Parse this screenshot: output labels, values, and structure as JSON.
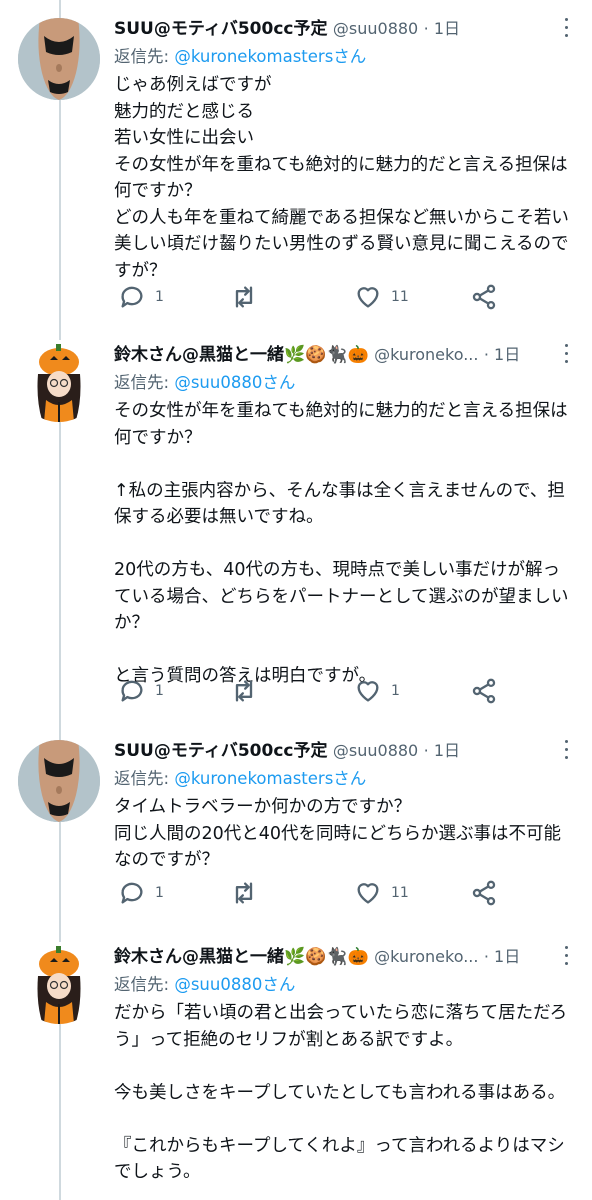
{
  "tweets": [
    {
      "author": "SUU@モティバ500cc予定",
      "handle": "@suu0880",
      "time": "· 1日",
      "reply_prefix": "返信先: ",
      "reply_to": "@kuronekomastersさん",
      "text": "じゃあ例えばですが\n魅力的だと感じる\n若い女性に出会い\nその女性が年を重ねても絶対的に魅力的だと言える担保は何ですか？\nどの人も年を重ねて綺麗である担保など無いからこそ若い美しい頃だけ齧りたい男性のずる賢い意見に聞こえるのですが？",
      "replies": "1",
      "retweets": "",
      "likes": "11"
    },
    {
      "author": "鈴木さん@黒猫と一緒",
      "emojis": [
        "🌿",
        "🍪",
        "🐈‍⬛",
        "🎃"
      ],
      "handle": "@kuroneko...",
      "time": "· 1日",
      "reply_prefix": "返信先: ",
      "reply_to": "@suu0880さん",
      "text": "その女性が年を重ねても絶対的に魅力的だと言える担保は何ですか？\n\n↑私の主張内容から、そんな事は全く言えませんので、担保する必要は無いですね。\n\n20代の方も、40代の方も、現時点で美しい事だけが解っている場合、どちらをパートナーとして選ぶのが望ましいか？\n\nと言う質問の答えは明白ですが。",
      "replies": "1",
      "retweets": "",
      "likes": "1"
    },
    {
      "author": "SUU@モティバ500cc予定",
      "handle": "@suu0880",
      "time": "· 1日",
      "reply_prefix": "返信先: ",
      "reply_to": "@kuronekomastersさん",
      "text": "タイムトラベラーか何かの方ですか？\n同じ人間の20代と40代を同時にどちらか選ぶ事は不可能なのですが？",
      "replies": "1",
      "retweets": "",
      "likes": "11"
    },
    {
      "author": "鈴木さん@黒猫と一緒",
      "emojis": [
        "🌿",
        "🍪",
        "🐈‍⬛",
        "🎃"
      ],
      "handle": "@kuroneko...",
      "time": "· 1日",
      "reply_prefix": "返信先: ",
      "reply_to": "@suu0880さん",
      "text": "だから「若い頃の君と出会っていたら恋に落ちて居ただろう」って拒絶のセリフが割とある訳ですよ。\n\n今も美しさをキープしていたとしても言われる事はある。\n\n『これからもキープしてくれよ』って言われるよりはマシでしょう。"
    }
  ]
}
